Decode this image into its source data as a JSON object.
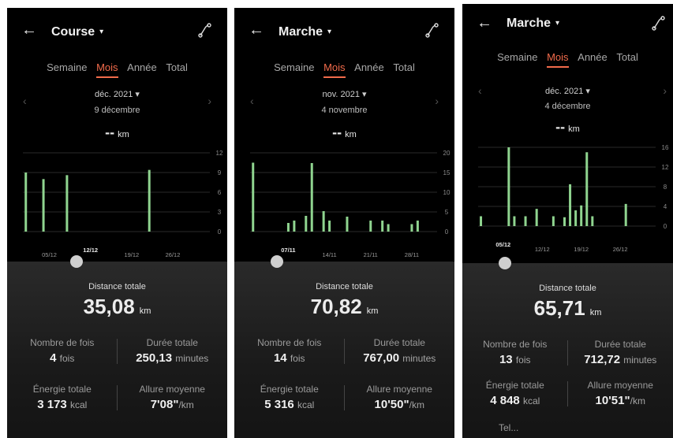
{
  "colors": {
    "accent": "#f26b4b",
    "bar": "#8fd48f",
    "background": "#000000"
  },
  "icons": {
    "back": "back-arrow-icon",
    "dropdown": "caret-down-icon",
    "route": "route-icon",
    "prev": "chevron-left-icon",
    "next": "chevron-right-icon"
  },
  "panels": [
    {
      "title": "Course",
      "title_caret": "▾",
      "tabs": [
        "Semaine",
        "Mois",
        "Année",
        "Total"
      ],
      "active_tab": 1,
      "month": "déc. 2021 ▾",
      "selected_day": "9 décembre",
      "distance_placeholder": "--",
      "distance_unit": "km",
      "distance_total_label": "Distance totale",
      "distance_total_value": "35,08",
      "distance_total_unit": "km",
      "stats": {
        "count_label": "Nombre de fois",
        "count_value": "4",
        "count_unit": "fois",
        "duration_label": "Durée totale",
        "duration_value": "250,13",
        "duration_unit": "minutes",
        "energy_label": "Énergie totale",
        "energy_value": "3 173",
        "energy_unit": "kcal",
        "pace_label": "Allure moyenne",
        "pace_value": "7'08\"",
        "pace_unit": "/km"
      },
      "chart_data": {
        "type": "bar",
        "y_ticks": [
          "12",
          "9",
          "6",
          "3",
          "0"
        ],
        "ylim": [
          0,
          12
        ],
        "x_ticks": [
          "05/12",
          "12/12",
          "19/12",
          "26/12"
        ],
        "highlighted_tick": "12/12",
        "x": [
          1,
          4,
          8,
          22
        ],
        "values": [
          9.0,
          8.0,
          8.6,
          9.4
        ]
      }
    },
    {
      "title": "Marche",
      "title_caret": "▾",
      "tabs": [
        "Semaine",
        "Mois",
        "Année",
        "Total"
      ],
      "active_tab": 1,
      "month": "nov. 2021 ▾",
      "selected_day": "4 novembre",
      "distance_placeholder": "--",
      "distance_unit": "km",
      "distance_total_label": "Distance totale",
      "distance_total_value": "70,82",
      "distance_total_unit": "km",
      "stats": {
        "count_label": "Nombre de fois",
        "count_value": "14",
        "count_unit": "fois",
        "duration_label": "Durée totale",
        "duration_value": "767,00",
        "duration_unit": "minutes",
        "energy_label": "Énergie totale",
        "energy_value": "5 316",
        "energy_unit": "kcal",
        "pace_label": "Allure moyenne",
        "pace_value": "10'50\"",
        "pace_unit": "/km"
      },
      "chart_data": {
        "type": "bar",
        "y_ticks": [
          "20",
          "15",
          "10",
          "5",
          "0"
        ],
        "ylim": [
          0,
          20
        ],
        "x_ticks": [
          "07/11",
          "14/11",
          "21/11",
          "28/11"
        ],
        "highlighted_tick": "07/11",
        "x": [
          1,
          7,
          8,
          10,
          11,
          13,
          14,
          17,
          21,
          23,
          24,
          28,
          29
        ],
        "values": [
          17.5,
          2.2,
          2.8,
          4.0,
          17.4,
          5.2,
          2.8,
          3.8,
          2.8,
          2.8,
          1.9,
          1.9,
          2.8
        ]
      }
    },
    {
      "title": "Marche",
      "title_caret": "▾",
      "tabs": [
        "Semaine",
        "Mois",
        "Année",
        "Total"
      ],
      "active_tab": 1,
      "month": "déc. 2021 ▾",
      "selected_day": "4 décembre",
      "distance_placeholder": "--",
      "distance_unit": "km",
      "distance_total_label": "Distance totale",
      "distance_total_value": "65,71",
      "distance_total_unit": "km",
      "stats": {
        "count_label": "Nombre de fois",
        "count_value": "13",
        "count_unit": "fois",
        "duration_label": "Durée totale",
        "duration_value": "712,72",
        "duration_unit": "minutes",
        "energy_label": "Énergie totale",
        "energy_value": "4 848",
        "energy_unit": "kcal",
        "pace_label": "Allure moyenne",
        "pace_value": "10'51\"",
        "pace_unit": "/km"
      },
      "extra_label": "Tel...",
      "chart_data": {
        "type": "bar",
        "y_ticks": [
          "16",
          "12",
          "8",
          "4",
          "0"
        ],
        "ylim": [
          0,
          16
        ],
        "x_ticks": [
          "05/12",
          "12/12",
          "19/12",
          "26/12"
        ],
        "highlighted_tick": "05/12",
        "x": [
          1,
          6,
          7,
          9,
          11,
          14,
          16,
          17,
          18,
          19,
          20,
          21,
          27
        ],
        "values": [
          2.0,
          16.0,
          2.0,
          2.0,
          3.5,
          2.0,
          1.8,
          8.5,
          3.2,
          4.2,
          15.0,
          2.0,
          4.5
        ]
      }
    }
  ]
}
